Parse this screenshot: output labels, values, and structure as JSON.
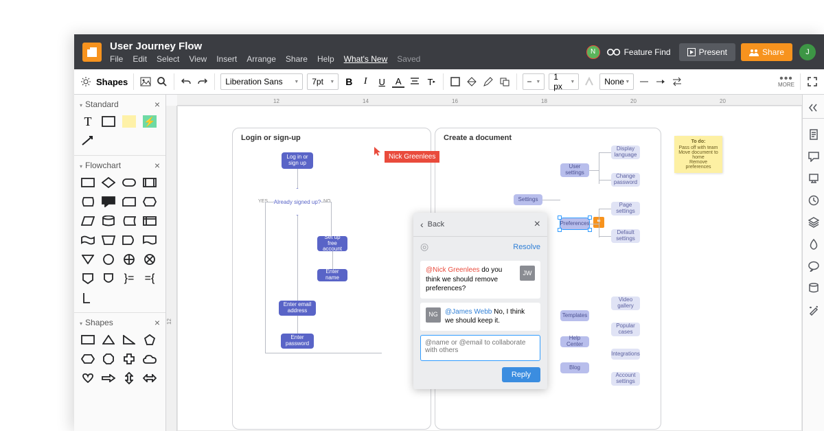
{
  "doc_title": "User Journey Flow",
  "menu": {
    "file": "File",
    "edit": "Edit",
    "select": "Select",
    "view": "View",
    "insert": "Insert",
    "arrange": "Arrange",
    "share": "Share",
    "help": "Help",
    "whatsnew": "What's New",
    "saved": "Saved"
  },
  "header": {
    "collab_initial": "N",
    "feature_find": "Feature Find",
    "present": "Present",
    "share": "Share",
    "avatar": "J"
  },
  "toolbar": {
    "shapes": "Shapes",
    "font": "Liberation Sans",
    "size": "7pt",
    "line_width": "1 px",
    "fill": "None",
    "more": "MORE"
  },
  "ruler_h": [
    "12",
    "14",
    "16",
    "18",
    "20"
  ],
  "ruler_v": [
    "12"
  ],
  "palettes": {
    "standard": "Standard",
    "flowchart": "Flowchart",
    "shapes": "Shapes"
  },
  "containers": {
    "login": "Login or sign-up",
    "create": "Create a document"
  },
  "nodes": {
    "login_signup": "Log in or sign up",
    "already": "Already signed up?",
    "yes": "YES",
    "no": "NO",
    "setup": "Set up free account",
    "enter_name": "Enter name",
    "enter_email": "Enter email address",
    "enter_pw": "Enter password",
    "settings": "Settings",
    "user_settings": "User settings",
    "preferences": "Preferences",
    "templates": "Templates",
    "help_center": "Help Center",
    "blog": "Blog",
    "disp_lang": "Display language",
    "change_pw": "Change password",
    "page_settings": "Page settings",
    "default_settings": "Default settings",
    "video_gallery": "Video gallery",
    "popular_cases": "Popular cases",
    "integrations": "Integrations",
    "account_settings": "Account settings"
  },
  "cursor_name": "Nick Greenlees",
  "sticky": {
    "title": "To do:",
    "l1": "Pass off with team",
    "l2": "Move document to home",
    "l3": "Remove preferences"
  },
  "comments": {
    "back": "Back",
    "resolve": "Resolve",
    "msg1_mention": "@Nick Greenlees",
    "msg1_text": " do you think we should remove preferences?",
    "msg1_av": "JW",
    "msg2_mention": "@James Webb",
    "msg2_text": " No, I think we should keep it.",
    "msg2_av": "NG",
    "placeholder": "@name or @email to collaborate with others",
    "reply": "Reply"
  }
}
